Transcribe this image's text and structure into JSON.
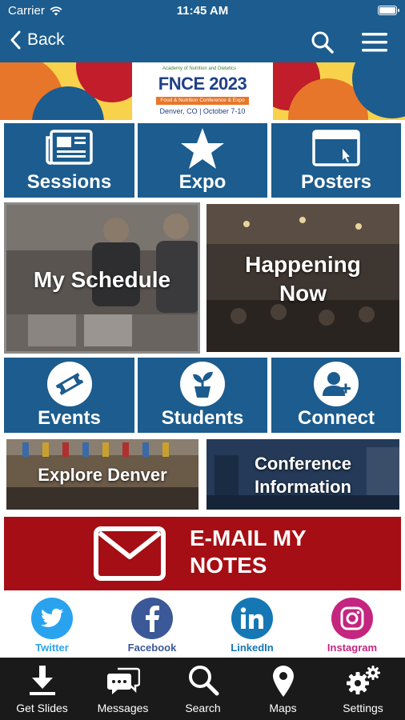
{
  "status_bar": {
    "carrier": "Carrier",
    "time": "11:45 AM"
  },
  "nav": {
    "back_label": "Back"
  },
  "banner": {
    "academy": "Academy of Nutrition and Dietetics",
    "title": "FNCE 2023",
    "subtitle": "Food & Nutrition Conference & Expo",
    "location": "Denver, CO  |  October 7-10"
  },
  "tiles": {
    "sessions": "Sessions",
    "expo": "Expo",
    "posters": "Posters",
    "my_schedule": "My Schedule",
    "happening_line1": "Happening",
    "happening_line2": "Now",
    "events": "Events",
    "students": "Students",
    "connect": "Connect",
    "explore_denver": "Explore Denver",
    "conference_line1": "Conference",
    "conference_line2": "Information",
    "email_line1": "E-MAIL MY",
    "email_line2": "NOTES"
  },
  "social": [
    {
      "label": "Twitter",
      "color": "#2aa3ef"
    },
    {
      "label": "Facebook",
      "color": "#3b5998"
    },
    {
      "label": "LinkedIn",
      "color": "#1677b5"
    },
    {
      "label": "Instagram",
      "color": "#c3257f"
    }
  ],
  "tabs": [
    {
      "label": "Get Slides",
      "icon": "download-icon"
    },
    {
      "label": "Messages",
      "icon": "messages-icon"
    },
    {
      "label": "Search",
      "icon": "search-icon"
    },
    {
      "label": "Maps",
      "icon": "map-pin-icon"
    },
    {
      "label": "Settings",
      "icon": "gears-icon"
    }
  ],
  "colors": {
    "primary_blue": "#1c5c8e",
    "email_red": "#a50e14",
    "tab_bar": "#1a1a1a"
  }
}
